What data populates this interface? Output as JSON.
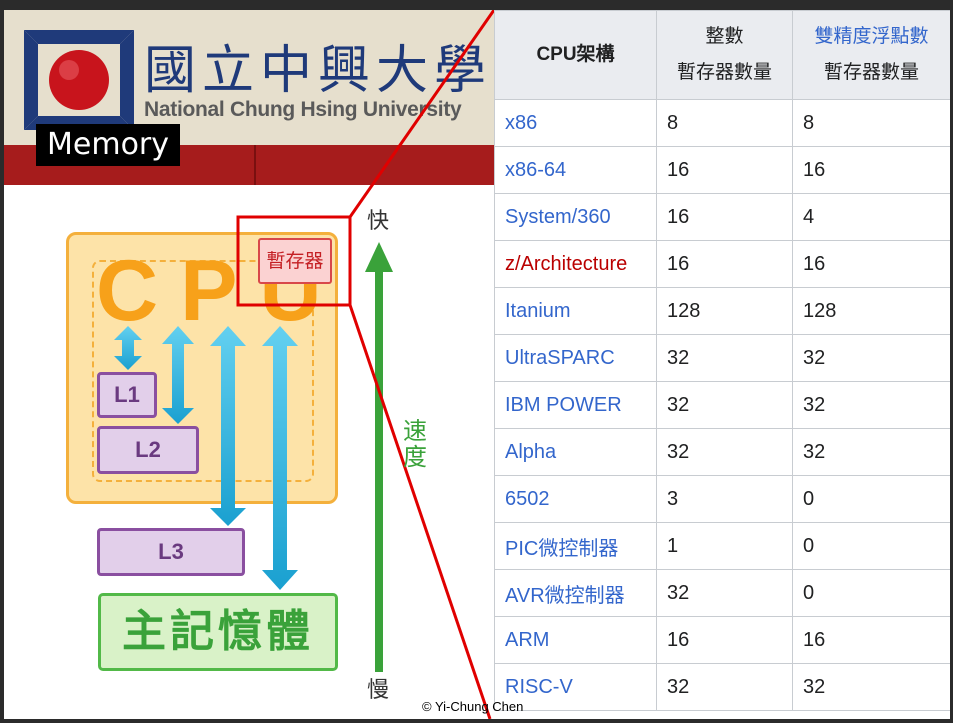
{
  "banner": {
    "university_cn": "國立中興大學",
    "university_en": "National Chung Hsing University",
    "section_title": "Memory"
  },
  "hierarchy": {
    "cpu_label": "CPU",
    "register_label": "暫存器",
    "l1_label": "L1",
    "l2_label": "L2",
    "l3_label": "L3",
    "main_memory_label": "主記憶體",
    "fast_label": "快",
    "slow_label": "慢",
    "speed_label": "速度"
  },
  "credit": "© Yi-Chung Chen",
  "table": {
    "headers": {
      "arch": "CPU架構",
      "int_line1": "整數",
      "int_line2": "暫存器數量",
      "fp_line1": "雙精度浮點數",
      "fp_line2": "暫存器數量"
    },
    "rows": [
      {
        "arch": "x86",
        "int": "8",
        "fp": "8"
      },
      {
        "arch": "x86-64",
        "int": "16",
        "fp": "16"
      },
      {
        "arch": "System/360",
        "int": "16",
        "fp": "4"
      },
      {
        "arch": "z/Architecture",
        "int": "16",
        "fp": "16"
      },
      {
        "arch": "Itanium",
        "int": "128",
        "fp": "128"
      },
      {
        "arch": "UltraSPARC",
        "int": "32",
        "fp": "32"
      },
      {
        "arch": "IBM POWER",
        "int": "32",
        "fp": "32"
      },
      {
        "arch": "Alpha",
        "int": "32",
        "fp": "32"
      },
      {
        "arch": "6502",
        "int": "3",
        "fp": "0"
      },
      {
        "arch": "PIC微控制器",
        "int": "1",
        "fp": "0"
      },
      {
        "arch": "AVR微控制器",
        "int": "32",
        "fp": "0"
      },
      {
        "arch": "ARM",
        "int": "16",
        "fp": "16"
      },
      {
        "arch": "RISC-V",
        "int": "32",
        "fp": "32"
      }
    ]
  },
  "colors": {
    "link": "#3366cc",
    "red_link": "#ba0000",
    "cpu_orange": "#f7a11a",
    "cache_purple": "#8a4fa0",
    "memory_green": "#3aa23a",
    "highlight_red": "#e00000",
    "arrow_blue": "#1aa0d0"
  }
}
